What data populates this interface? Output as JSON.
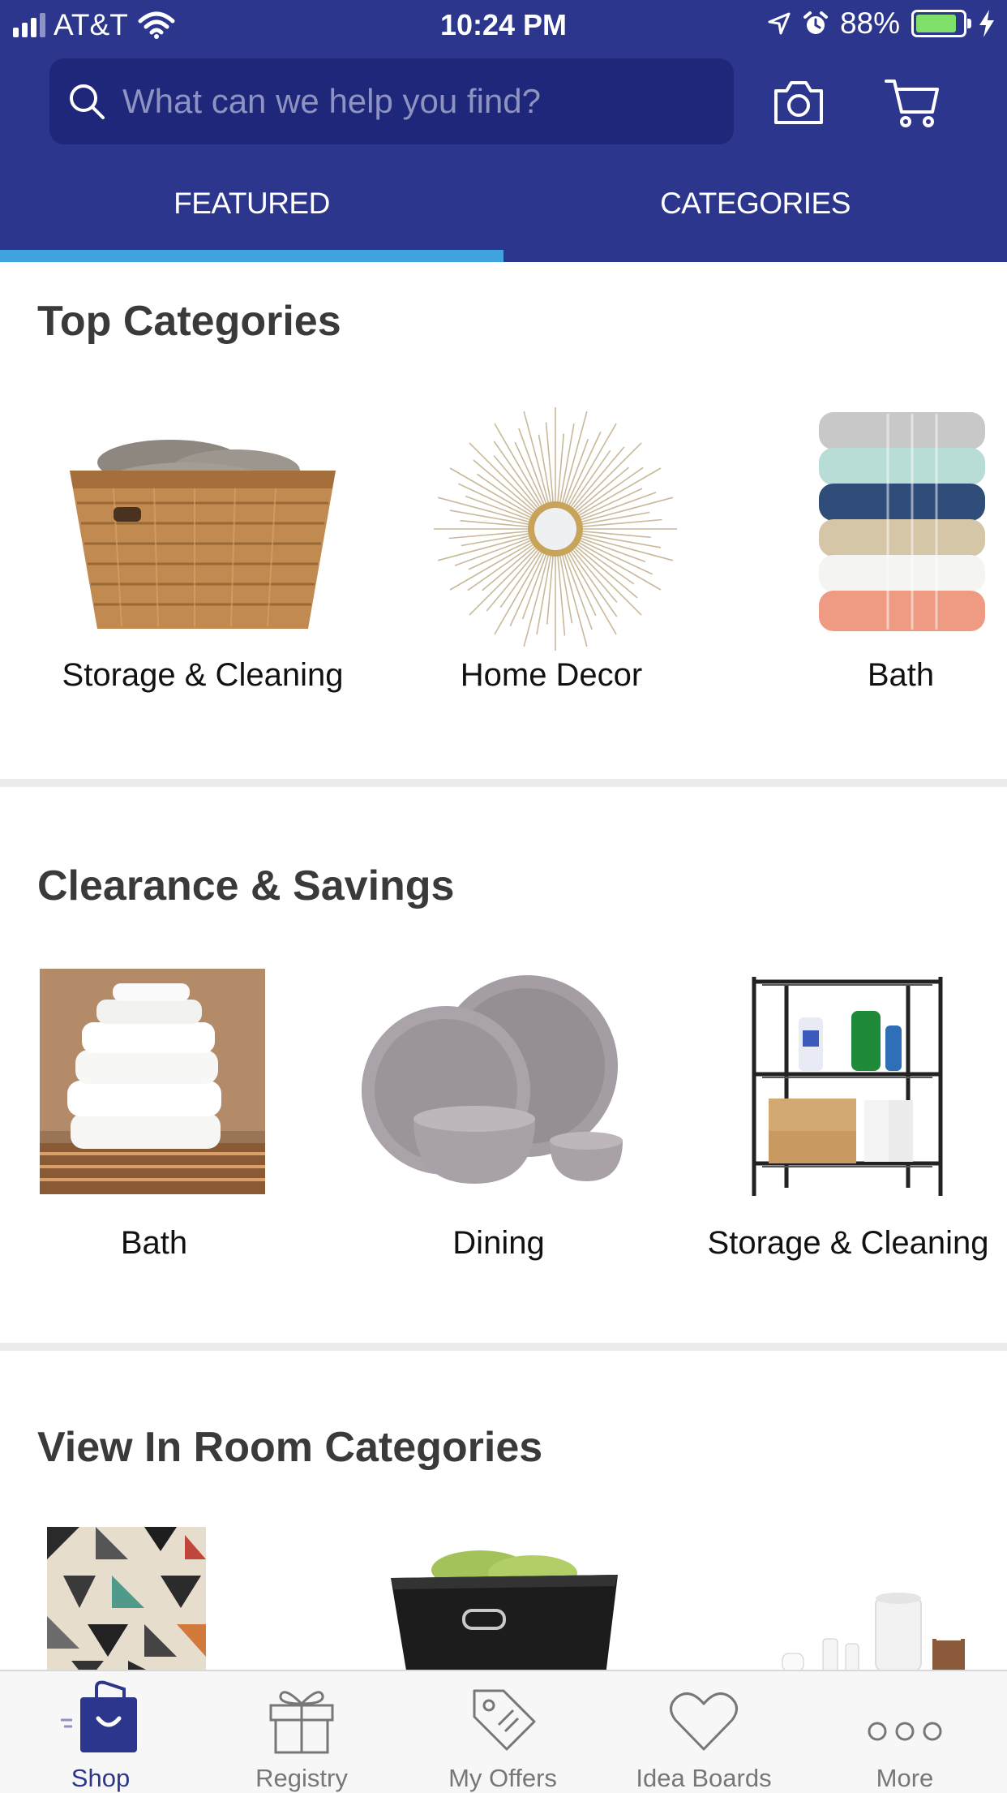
{
  "status_bar": {
    "carrier": "AT&T",
    "time": "10:24 PM",
    "battery_percent": "88%",
    "battery_level": 0.88
  },
  "search": {
    "placeholder": "What can we help you find?"
  },
  "header_icons": [
    "camera-icon",
    "cart-icon"
  ],
  "tabs": {
    "featured": "FEATURED",
    "categories": "CATEGORIES",
    "active": "featured"
  },
  "sections": {
    "top_categories": {
      "title": "Top Categories",
      "items": [
        {
          "label": "Storage & Cleaning",
          "image": "woven-basket-with-towels"
        },
        {
          "label": "Home Decor",
          "image": "sunburst-mirror"
        },
        {
          "label": "Bath",
          "image": "stacked-colorful-towels"
        }
      ]
    },
    "clearance": {
      "title": "Clearance & Savings",
      "items": [
        {
          "label": "Bath",
          "image": "white-towel-stack"
        },
        {
          "label": "Dining",
          "image": "gray-dinnerware-set"
        },
        {
          "label": "Storage & Cleaning",
          "image": "wire-shelving-unit"
        }
      ]
    },
    "view_in_room": {
      "title": "View In Room Categories",
      "items": [
        {
          "image": "geometric-rug"
        },
        {
          "image": "black-storage-bin-with-towels"
        },
        {
          "image": "bath-accessories"
        }
      ]
    }
  },
  "tabbar": {
    "items": [
      {
        "label": "Shop",
        "icon": "shopping-bag-icon",
        "active": true
      },
      {
        "label": "Registry",
        "icon": "gift-icon",
        "active": false
      },
      {
        "label": "My Offers",
        "icon": "tag-icon",
        "active": false
      },
      {
        "label": "Idea Boards",
        "icon": "heart-icon",
        "active": false
      },
      {
        "label": "More",
        "icon": "more-dots-icon",
        "active": false
      }
    ]
  },
  "colors": {
    "header": "#2c368c",
    "search_bg": "#1e2779",
    "tab_indicator": "#3fa3e0",
    "tabbar_active": "#2c368c"
  }
}
